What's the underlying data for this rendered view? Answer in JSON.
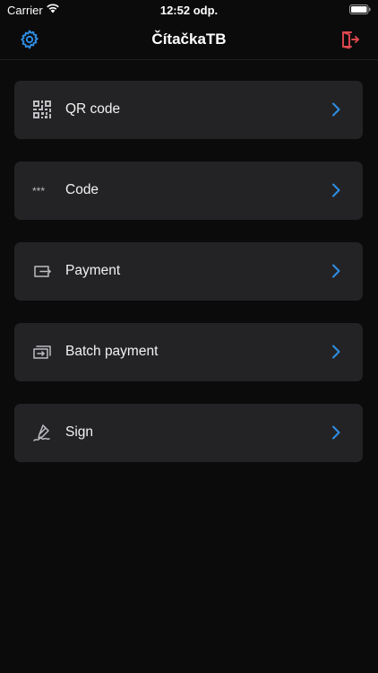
{
  "status_bar": {
    "carrier": "Carrier",
    "time": "12:52 odp."
  },
  "nav": {
    "title": "ČítačkaTB"
  },
  "menu": {
    "items": [
      {
        "label": "QR code",
        "icon": "qr-code-icon"
      },
      {
        "label": "Code",
        "icon": "asterisk-code-icon",
        "icon_text": "***"
      },
      {
        "label": "Payment",
        "icon": "wallet-arrow-icon"
      },
      {
        "label": "Batch payment",
        "icon": "batch-payment-icon"
      },
      {
        "label": "Sign",
        "icon": "signature-pen-icon"
      }
    ]
  },
  "colors": {
    "accent": "#2f8fe6",
    "logout": "#e0484f",
    "card": "#232325",
    "background": "#0b0b0c"
  }
}
